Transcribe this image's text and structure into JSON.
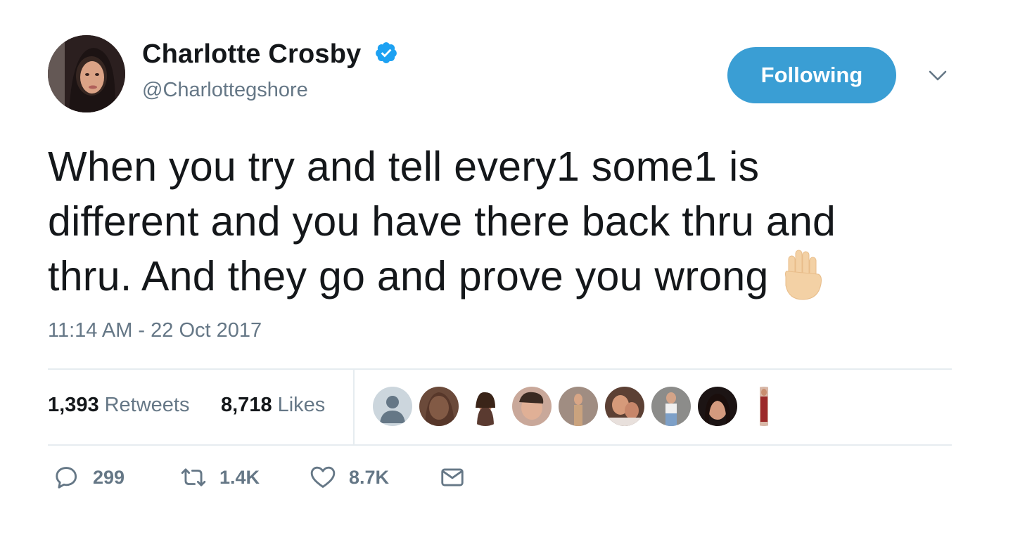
{
  "user": {
    "display_name": "Charlotte Crosby",
    "handle": "@Charlottegshore",
    "verified_icon": "verified-badge-icon"
  },
  "header": {
    "follow_label": "Following",
    "menu_icon": "chevron-down-icon"
  },
  "tweet": {
    "text": "When you try and tell every1 some1 is different and you have there back thru and thru. And they go and prove you wrong",
    "emoji": "raised-hand-emoji",
    "timestamp": "11:14 AM - 22 Oct 2017"
  },
  "stats": {
    "retweets_count": "1,393",
    "retweets_label": "Retweets",
    "likes_count": "8,718",
    "likes_label": "Likes",
    "liker_avatars": 9
  },
  "actions": {
    "reply_count": "299",
    "retweet_count": "1.4K",
    "like_count": "8.7K"
  },
  "colors": {
    "accent": "#3a9ed4",
    "verified": "#1da1f2",
    "secondary_text": "#657786",
    "primary_text": "#14171a",
    "divider": "#e6ecf0"
  }
}
